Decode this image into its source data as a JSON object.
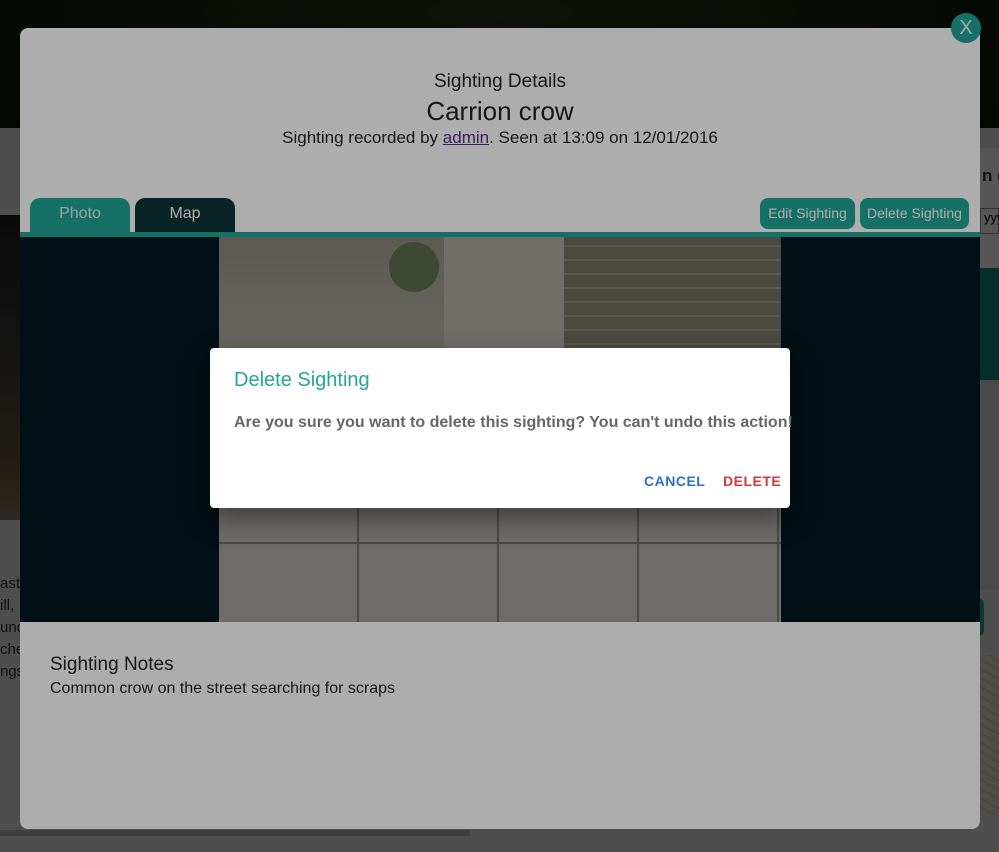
{
  "background": {
    "left_text_lines": [
      "aste",
      "ill,",
      "und",
      "che",
      "ngs"
    ],
    "right_heading_fragment": "n c",
    "right_input_fragment": "yyy"
  },
  "details_modal": {
    "subtitle": "Sighting Details",
    "species": "Carrion crow",
    "recorded_prefix": "Sighting recorded by ",
    "recorded_user": "admin",
    "recorded_suffix": ". Seen at 13:09 on 12/01/2016",
    "tabs": [
      {
        "label": "Photo"
      },
      {
        "label": "Map"
      }
    ],
    "edit_label": "Edit Sighting",
    "delete_label": "Delete Sighting",
    "notes_title": "Sighting Notes",
    "notes_text": "Common crow on the street searching for scraps",
    "close_label": "X"
  },
  "confirm_dialog": {
    "title": "Delete Sighting",
    "message": "Are you sure you want to delete this sighting? You can't undo this action!",
    "cancel_label": "CANCEL",
    "delete_label": "DELETE"
  },
  "colors": {
    "accent": "#23a597",
    "dark_tab": "#0c3436",
    "cancel": "#2f6fc1",
    "danger": "#d23a3a"
  }
}
